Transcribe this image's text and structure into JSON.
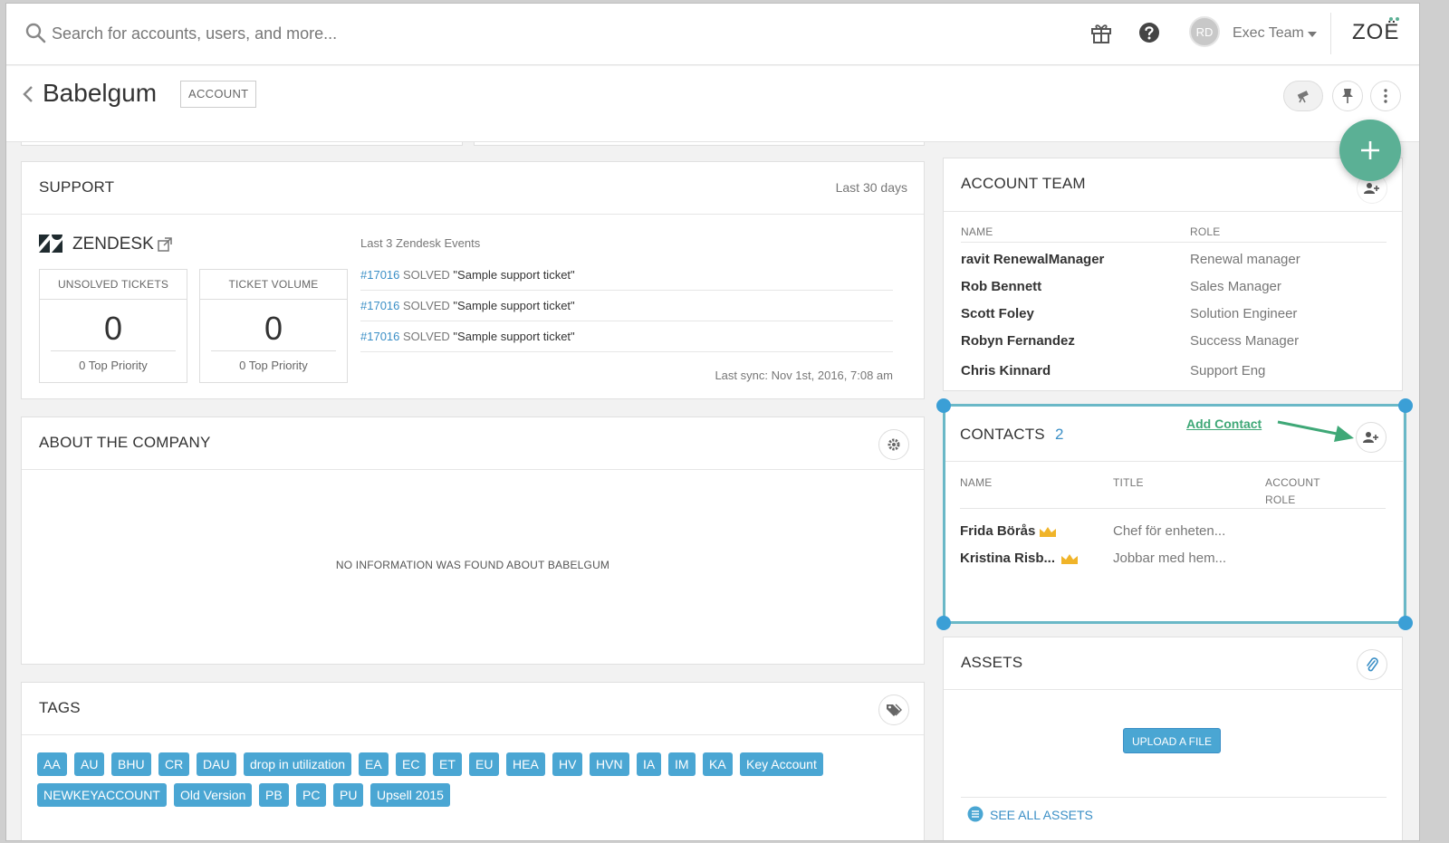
{
  "topbar": {
    "search_placeholder": "Search for accounts, users, and more...",
    "avatar_initials": "RD",
    "team_name": "Exec Team",
    "logo_text": "ZOË"
  },
  "header": {
    "title": "Babelgum",
    "badge": "ACCOUNT"
  },
  "support": {
    "title": "SUPPORT",
    "range": "Last 30 days",
    "provider": "ZENDESK",
    "stats": [
      {
        "label": "UNSOLVED TICKETS",
        "value": "0",
        "foot": "0 Top Priority"
      },
      {
        "label": "TICKET VOLUME",
        "value": "0",
        "foot": "0 Top Priority"
      }
    ],
    "events_title": "Last 3 Zendesk Events",
    "events": [
      {
        "id": "#17016",
        "status": "SOLVED",
        "subject": "\"Sample support ticket\""
      },
      {
        "id": "#17016",
        "status": "SOLVED",
        "subject": "\"Sample support ticket\""
      },
      {
        "id": "#17016",
        "status": "SOLVED",
        "subject": "\"Sample support ticket\""
      }
    ],
    "last_sync": "Last sync: Nov 1st, 2016, 7:08 am"
  },
  "about": {
    "title": "ABOUT THE COMPANY",
    "empty_text": "NO INFORMATION WAS FOUND ABOUT BABELGUM"
  },
  "tags": {
    "title": "TAGS",
    "row1": [
      "AA",
      "AU",
      "BHU",
      "CR",
      "DAU",
      "drop in utilization",
      "EA",
      "EC",
      "ET",
      "EU",
      "HEA",
      "HV",
      "HVN",
      "IA",
      "IM",
      "KA",
      "Key Account"
    ],
    "row2": [
      "NEWKEYACCOUNT",
      "Old Version",
      "PB",
      "PC",
      "PU",
      "Upsell 2015"
    ]
  },
  "account_team": {
    "title": "ACCOUNT TEAM",
    "col_name": "NAME",
    "col_role": "ROLE",
    "rows": [
      {
        "name": "ravit RenewalManager",
        "role": "Renewal manager"
      },
      {
        "name": "Rob Bennett",
        "role": "Sales Manager"
      },
      {
        "name": "Scott Foley",
        "role": "Solution Engineer"
      },
      {
        "name": "Robyn Fernandez",
        "role": "Success Manager"
      },
      {
        "name": "Chris Kinnard",
        "role": "Support Eng"
      }
    ]
  },
  "contacts": {
    "title": "CONTACTS",
    "count": "2",
    "annotation": "Add Contact",
    "col_name": "NAME",
    "col_title": "TITLE",
    "col_role_1": "ACCOUNT",
    "col_role_2": "ROLE",
    "rows": [
      {
        "name": "Frida Börås",
        "title": "Chef för enheten..."
      },
      {
        "name": "Kristina Risb...",
        "title": "Jobbar med hem..."
      }
    ]
  },
  "assets": {
    "title": "ASSETS",
    "upload_label": "UPLOAD A FILE",
    "see_all": "SEE ALL ASSETS"
  },
  "colors": {
    "accent": "#4aa6d3",
    "fab": "#5bb095",
    "annotation": "#3fa877",
    "crown": "#f0b429"
  }
}
